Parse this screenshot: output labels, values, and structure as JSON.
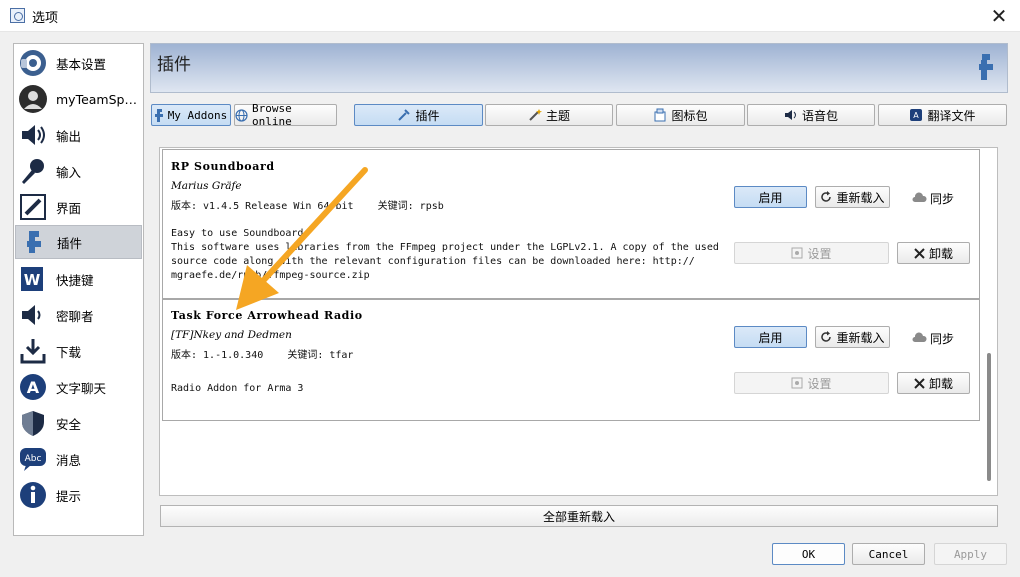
{
  "window": {
    "title": "选项",
    "close": "✕"
  },
  "sidebar": {
    "items": [
      {
        "label": "基本设置",
        "icon": "teamspeak-icon"
      },
      {
        "label": "myTeamSpe...",
        "icon": "user-icon"
      },
      {
        "label": "输出",
        "icon": "speaker-icon"
      },
      {
        "label": "输入",
        "icon": "microphone-icon"
      },
      {
        "label": "界面",
        "icon": "design-icon"
      },
      {
        "label": "插件",
        "icon": "plugin-icon",
        "selected": true
      },
      {
        "label": "快捷键",
        "icon": "hotkey-icon"
      },
      {
        "label": "密聊者",
        "icon": "whisper-icon"
      },
      {
        "label": "下载",
        "icon": "download-icon"
      },
      {
        "label": "文字聊天",
        "icon": "text-chat-icon"
      },
      {
        "label": "安全",
        "icon": "security-icon"
      },
      {
        "label": "消息",
        "icon": "messages-icon"
      },
      {
        "label": "提示",
        "icon": "info-icon"
      }
    ]
  },
  "header": {
    "title": "插件"
  },
  "source_tabs": {
    "my_addons": "My Addons",
    "browse_online": "Browse online"
  },
  "category_tabs": [
    {
      "label": "插件",
      "icon": "plugin-icon",
      "active": true
    },
    {
      "label": "主题",
      "icon": "theme-wand-icon"
    },
    {
      "label": "图标包",
      "icon": "iconpack-icon"
    },
    {
      "label": "语音包",
      "icon": "soundpack-icon"
    },
    {
      "label": "翻译文件",
      "icon": "translation-icon"
    }
  ],
  "addons": [
    {
      "name": "RP Soundboard",
      "author": "Marius Gräfe",
      "version_line": "版本: v1.4.5 Release Win 64-bit    关键词: rpsb",
      "description": "Easy to use Soundboard\nThis software uses libraries from the FFmpeg project under the LGPLv2.1. A copy of the used\nsource code along with the relevant configuration files can be downloaded here: http://\nmgraefe.de/rpsb/ffmpeg-source.zip",
      "enable": "启用",
      "reload": "重新载入",
      "sync": "同步",
      "settings": "设置",
      "uninstall": "卸载"
    },
    {
      "name": "Task Force Arrowhead Radio",
      "author": "[TF]Nkey and Dedmen",
      "version_line": "版本: 1.-1.0.340    关键词: tfar",
      "description": "Radio Addon for Arma 3",
      "enable": "启用",
      "reload": "重新载入",
      "sync": "同步",
      "settings": "设置",
      "uninstall": "卸载"
    }
  ],
  "reload_all": "全部重新载入",
  "footer": {
    "ok": "OK",
    "cancel": "Cancel",
    "apply": "Apply"
  },
  "colors": {
    "accent": "#5c8ac4",
    "annotation_arrow": "#f5a623",
    "header_gradient_top": "#9fb3d3"
  }
}
